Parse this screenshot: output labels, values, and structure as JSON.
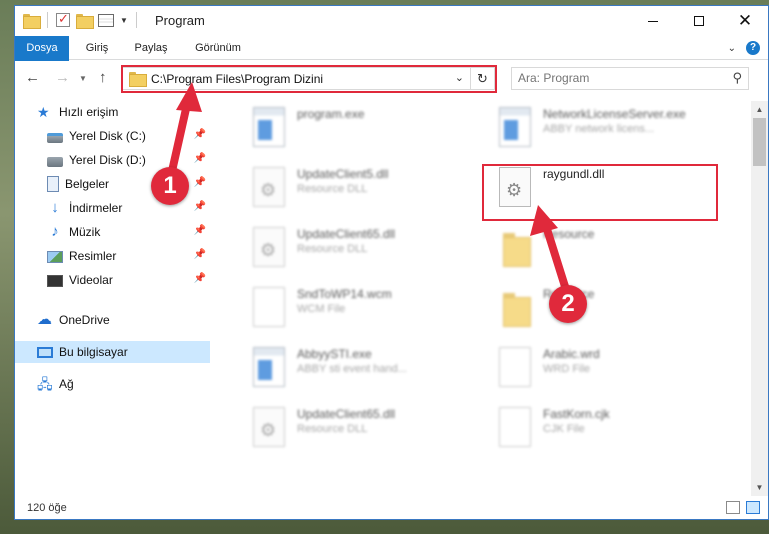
{
  "window": {
    "title": "Program",
    "minimize": "—",
    "close": "✕"
  },
  "ribbon": {
    "tabs": [
      "Dosya",
      "Giriş",
      "Paylaş",
      "Görünüm"
    ]
  },
  "address": {
    "path": "C:\\Program Files\\Program Dizini"
  },
  "search": {
    "placeholder": "Ara: Program"
  },
  "sidebar": {
    "items": [
      {
        "label": "Hızlı erişim",
        "icon": "star-icon"
      },
      {
        "label": "Yerel Disk (C:)",
        "icon": "disk-icon"
      },
      {
        "label": "Yerel Disk (D:)",
        "icon": "disk-icon"
      },
      {
        "label": "Belgeler",
        "icon": "documents-icon"
      },
      {
        "label": "İndirmeler",
        "icon": "downloads-icon"
      },
      {
        "label": "Müzik",
        "icon": "music-icon"
      },
      {
        "label": "Resimler",
        "icon": "pictures-icon"
      },
      {
        "label": "Videolar",
        "icon": "videos-icon"
      },
      {
        "label": "OneDrive",
        "icon": "onedrive-icon"
      },
      {
        "label": "Bu bilgisayar",
        "icon": "this-pc-icon"
      },
      {
        "label": "Ağ",
        "icon": "network-icon"
      }
    ]
  },
  "files": {
    "left": [
      {
        "name": "program.exe",
        "type": ""
      },
      {
        "name": "UpdateClient5.dll",
        "type": "Resource DLL"
      },
      {
        "name": "UpdateClient65.dll",
        "type": "Resource DLL"
      },
      {
        "name": "SndToWP14.wcm",
        "type": "WCM File"
      },
      {
        "name": "AbbyySTI.exe",
        "type": "ABBY sti event hand..."
      },
      {
        "name": "UpdateClient65.dll",
        "type": "Resource DLL"
      }
    ],
    "right": [
      {
        "name": "NetworkLicenseServer.exe",
        "type": "ABBY network licens..."
      },
      {
        "name": "raygundl.dll",
        "type": ""
      },
      {
        "name": "Resource",
        "type": ""
      },
      {
        "name": "Resource",
        "type": ""
      },
      {
        "name": "Arabic.wrd",
        "type": "WRD File"
      },
      {
        "name": "FastKorn.cjk",
        "type": "CJK File"
      }
    ]
  },
  "status": {
    "count": "120 öğe"
  },
  "annotations": {
    "badge1": "1",
    "badge2": "2",
    "color": "#e0293b"
  }
}
